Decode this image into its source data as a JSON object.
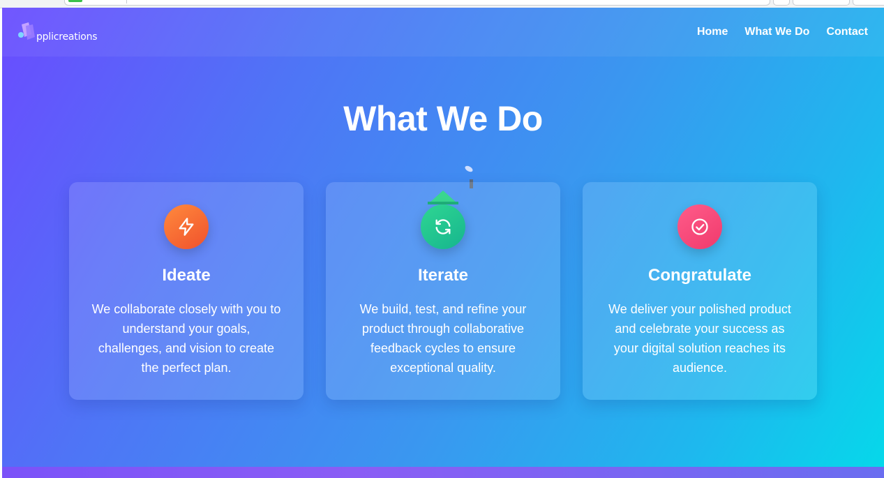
{
  "brand": {
    "logo_text": "pplicreations",
    "colors": {
      "gradient_start": "#6a4cff",
      "gradient_end": "#05d9ea",
      "ideate_icon": "#f0512c",
      "iterate_icon": "#16b58e",
      "congratulate_icon": "#f03a6c"
    }
  },
  "nav": {
    "items": [
      {
        "label": "Home"
      },
      {
        "label": "What We Do"
      },
      {
        "label": "Contact"
      }
    ]
  },
  "section": {
    "title": "What We Do",
    "cards": [
      {
        "title": "Ideate",
        "icon": "lightning-icon",
        "text": "We collaborate closely with you to understand your goals, challenges, and vision to create the perfect plan."
      },
      {
        "title": "Iterate",
        "icon": "refresh-icon",
        "text": "We build, test, and refine your product through collaborative feedback cycles to ensure exceptional quality."
      },
      {
        "title": "Congratulate",
        "icon": "check-circle-icon",
        "text": "We deliver your polished product and celebrate your success as your digital solution reaches its audience."
      }
    ]
  }
}
